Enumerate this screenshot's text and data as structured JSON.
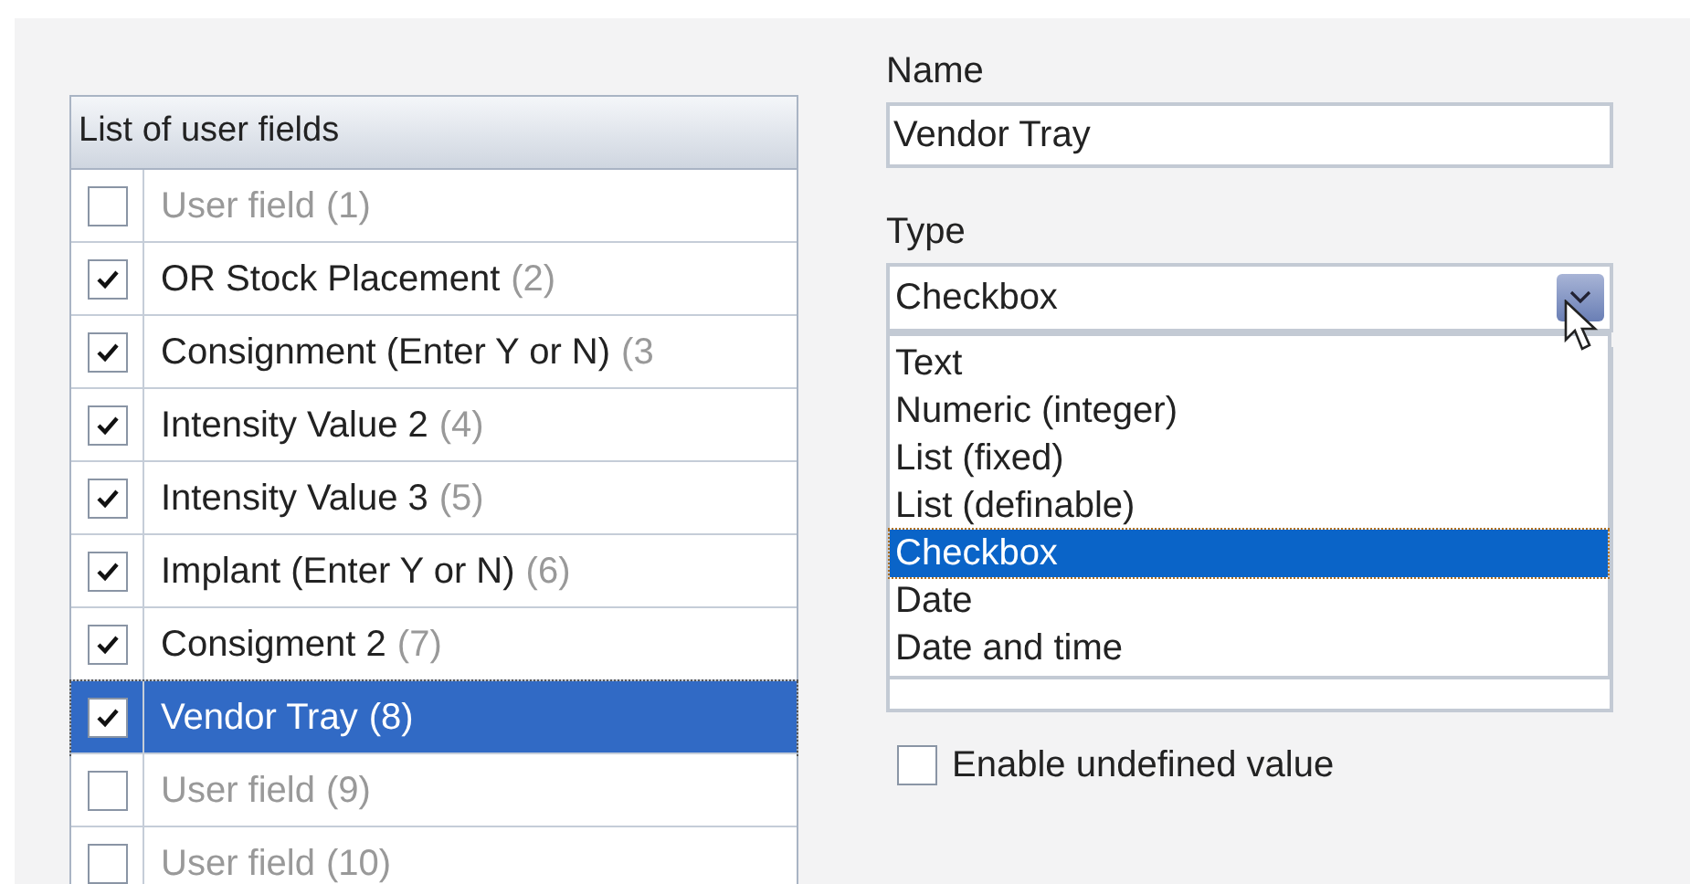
{
  "user_fields": {
    "header": "List of user fields",
    "items": [
      {
        "name": "User field",
        "number": "(1)",
        "checked": false,
        "selected": false
      },
      {
        "name": "OR Stock Placement",
        "number": "(2)",
        "checked": true,
        "selected": false
      },
      {
        "name": "Consignment (Enter Y or N)",
        "number": "(3",
        "checked": true,
        "selected": false
      },
      {
        "name": "Intensity Value 2",
        "number": "(4)",
        "checked": true,
        "selected": false
      },
      {
        "name": "Intensity Value 3",
        "number": "(5)",
        "checked": true,
        "selected": false
      },
      {
        "name": "Implant (Enter Y or N)",
        "number": "(6)",
        "checked": true,
        "selected": false
      },
      {
        "name": "Consigment 2",
        "number": "(7)",
        "checked": true,
        "selected": false
      },
      {
        "name": "Vendor Tray",
        "number": "(8)",
        "checked": true,
        "selected": true
      },
      {
        "name": "User field",
        "number": "(9)",
        "checked": false,
        "selected": false
      },
      {
        "name": "User field",
        "number": "(10)",
        "checked": false,
        "selected": false
      }
    ]
  },
  "name_field": {
    "label": "Name",
    "value": "Vendor Tray"
  },
  "type_field": {
    "label": "Type",
    "value": "Checkbox",
    "expanded": true,
    "options": [
      {
        "label": "Text",
        "selected": false
      },
      {
        "label": "Numeric (integer)",
        "selected": false
      },
      {
        "label": "List (fixed)",
        "selected": false
      },
      {
        "label": "List (definable)",
        "selected": false
      },
      {
        "label": "Checkbox",
        "selected": true
      },
      {
        "label": "Date",
        "selected": false
      },
      {
        "label": "Date and time",
        "selected": false
      }
    ]
  },
  "undefined_value": {
    "label": "Enable undefined value",
    "checked": false
  }
}
